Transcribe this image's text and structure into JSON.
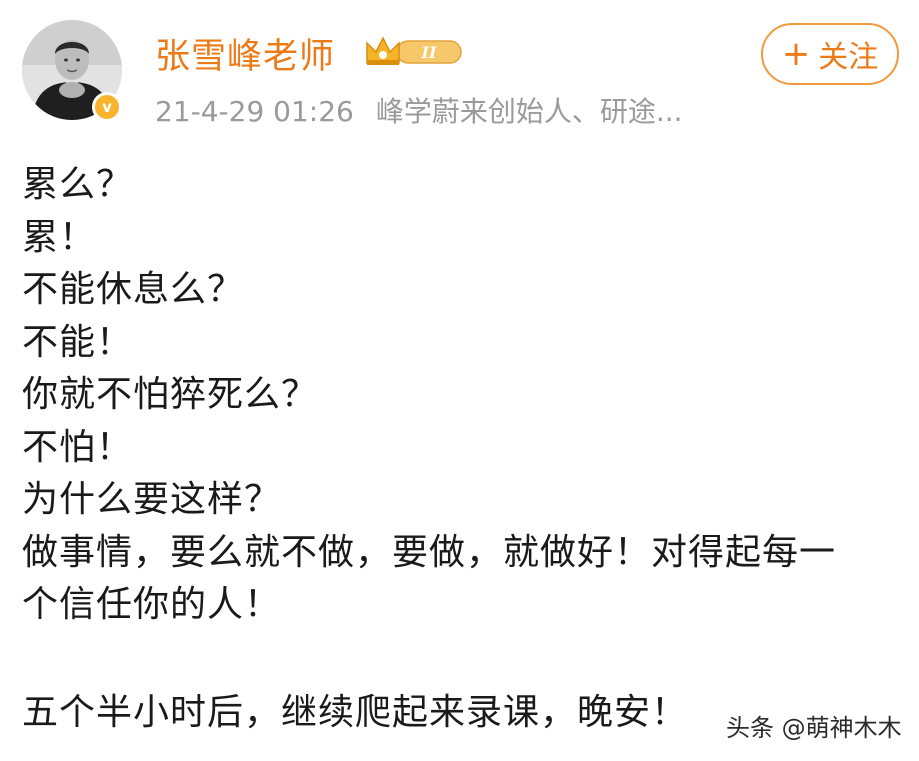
{
  "author": {
    "name": "张雪峰老师",
    "verified_mark": "v",
    "member_level": "II",
    "post_time": "21-4-29 01:26",
    "bio": "峰学蔚来创始人、研途..."
  },
  "actions": {
    "follow_plus": "+",
    "follow_label": "关注"
  },
  "post": {
    "lines": [
      "累么？",
      "累！",
      "不能休息么？",
      "不能！",
      "你就不怕猝死么？",
      "不怕！",
      "为什么要这样？",
      "做事情，要么就不做，要做，就做好！对得起每一",
      "个信任你的人！",
      "",
      "五个半小时后，继续爬起来录课，晚安！"
    ]
  },
  "watermark": {
    "text": "头条 @萌神木木"
  },
  "colors": {
    "accent": "#ec7a17",
    "meta_text": "#9a9a9a",
    "badge_gold": "#f7b42c"
  },
  "icons": {
    "avatar": "portrait-photo",
    "verified": "verified-badge-icon",
    "member": "crown-badge-icon"
  }
}
